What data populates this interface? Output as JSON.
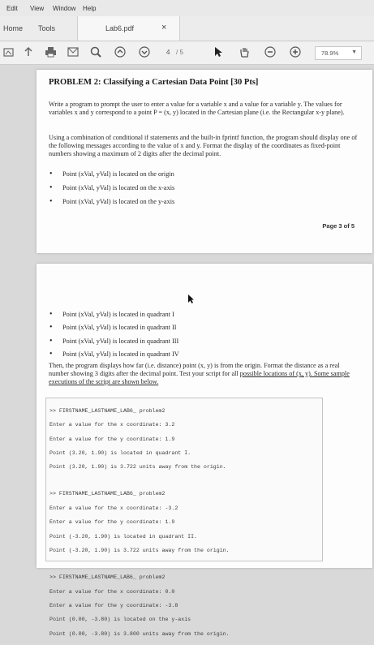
{
  "menu": [
    "Edit",
    "View",
    "Window",
    "Help"
  ],
  "tabs": {
    "home": "Home",
    "tools": "Tools",
    "doc": "Lab6.pdf",
    "close": "×"
  },
  "toolbar": {
    "page_current": "4",
    "page_total": "/ 5",
    "zoom": "78.9%"
  },
  "page3": {
    "title": "PROBLEM 2: Classifying a Cartesian Data Point [30 Pts]",
    "para1": "Write a program to prompt the user to enter a value for a variable x and a value for a variable y. The values for variables x and y correspond to a point P = (x, y) located in the Cartesian plane (i.e. the Rectangular x-y plane).",
    "para2": "Using a combination of conditional if statements and the built-in fprintf function, the program should display one of the following messages according to the value of x and y. Format the display of the coordinates as fixed-point numbers showing a maximum of 2 digits after the decimal point.",
    "bullets": [
      "Point (xVal, yVal) is located on the origin",
      "Point (xVal, yVal) is located on the x-axis",
      "Point (xVal, yVal) is located on the y-axis"
    ],
    "page_label": "Page 3 of 5"
  },
  "page4": {
    "bullets": [
      "Point (xVal, yVal) is located in quadrant I",
      "Point (xVal, yVal) is located in quadrant II",
      "Point (xVal, yVal) is located in quadrant III",
      "Point (xVal, yVal) is located in quadrant IV"
    ],
    "para": "Then, the program displays how far (i.e. distance) point (x, y) is from the origin. Format the distance as a real number showing 3 digits after the decimal point. Test your script for all ",
    "para_link": "possible locations of (x, y). Some sample executions of the script are shown below.",
    "terminal": [
      ">> FIRSTNAME_LASTNAME_LAB6_ problem2",
      "Enter a value for the x coordinate: 3.2",
      "Enter a value for the y coordinate: 1.9",
      "Point (3.20, 1.90) is located in quadrant I.",
      "Point (3.20, 1.90) is 3.722 units away from the origin.",
      "",
      ">> FIRSTNAME_LASTNAME_LAB6_ problem2",
      "Enter a value for the x coordinate: -3.2",
      "Enter a value for the y coordinate: 1.9",
      "Point (-3.20, 1.90) is located in quadrant II.",
      "Point (-3.20, 1.90) is 3.722 units away from the origin.",
      "",
      ">> FIRSTNAME_LASTNAME_LAB6_ problem2",
      "Enter a value for the x coordinate: 0.0",
      "Enter a value for the y coordinate: -3.8",
      "Point (0.00, -3.80) is located on the y-axis",
      "Point (0.00, -3.80) is 3.800 units away from the origin."
    ]
  }
}
